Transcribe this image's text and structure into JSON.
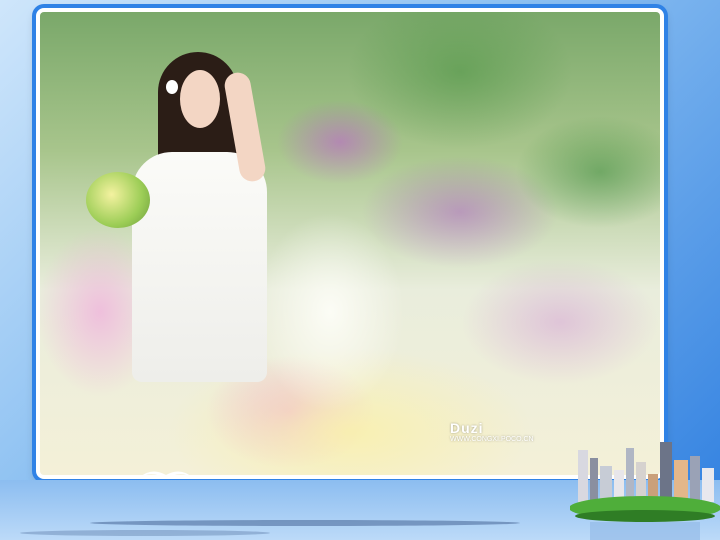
{
  "slide": {
    "photo_alt": "girl-in-white-dress-with-flowers-photo",
    "watermark": {
      "brand": "Duzi",
      "url": "WWW.CONGXI.POCO.CN"
    }
  },
  "colors": {
    "background_top": "#cfe6fb",
    "background_bottom": "#2f7fe0",
    "frame_border": "#2f82e6"
  },
  "decorations": {
    "bottom_left_icon": "open-book-icon",
    "bottom_right_icon": "city-skyline-icon"
  }
}
